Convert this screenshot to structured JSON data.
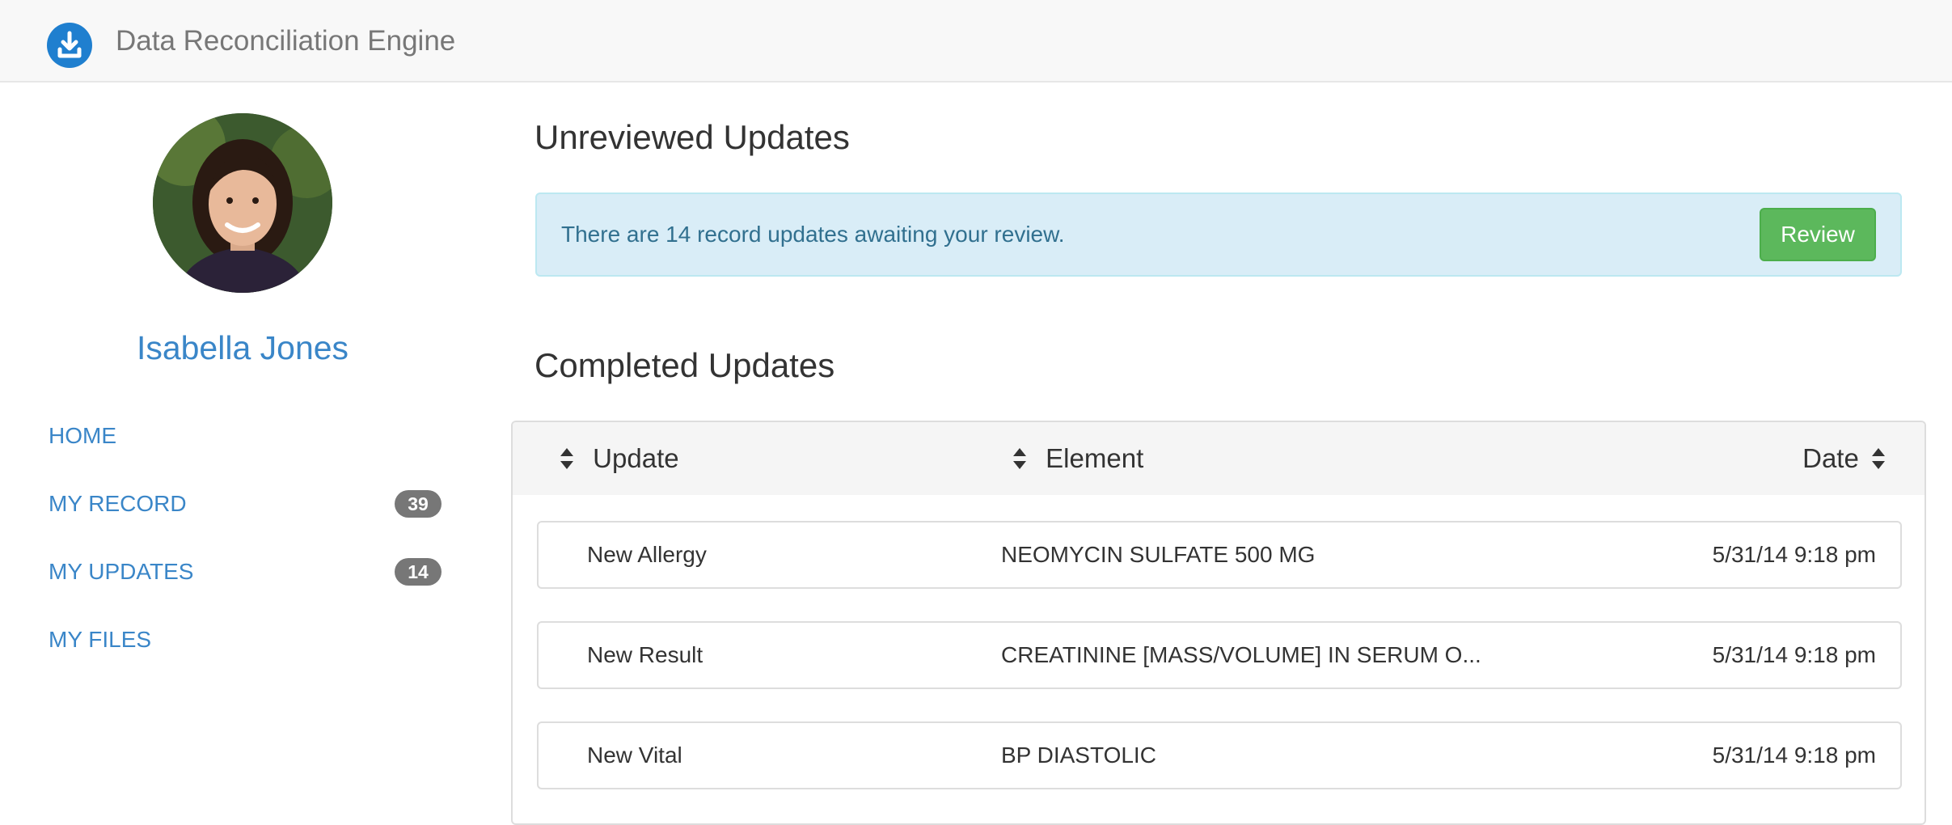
{
  "app": {
    "title": "Data Reconciliation Engine",
    "brand_icon": "download-icon",
    "accent_color": "#1f7fcf"
  },
  "sidebar": {
    "user_name": "Isabella Jones",
    "avatar": "avatar-photo",
    "items": [
      {
        "label": "HOME",
        "badge": ""
      },
      {
        "label": "MY RECORD",
        "badge": "39"
      },
      {
        "label": "MY UPDATES",
        "badge": "14"
      },
      {
        "label": "MY FILES",
        "badge": ""
      }
    ]
  },
  "unreviewed": {
    "heading": "Unreviewed Updates",
    "message": "There are 14 record updates awaiting your review.",
    "button_label": "Review",
    "button_color": "#5cb85c",
    "alert_color": "#d9edf7"
  },
  "completed": {
    "heading": "Completed Updates",
    "columns": [
      "Update",
      "Element",
      "Date"
    ],
    "sort_icon": "sort-icon",
    "rows": [
      {
        "update": "New Allergy",
        "element": "NEOMYCIN SULFATE 500 MG",
        "date": "5/31/14 9:18 pm"
      },
      {
        "update": "New Result",
        "element": "CREATININE [MASS/VOLUME] IN SERUM O...",
        "date": "5/31/14 9:18 pm"
      },
      {
        "update": "New Vital",
        "element": "BP DIASTOLIC",
        "date": "5/31/14 9:18 pm"
      }
    ]
  }
}
